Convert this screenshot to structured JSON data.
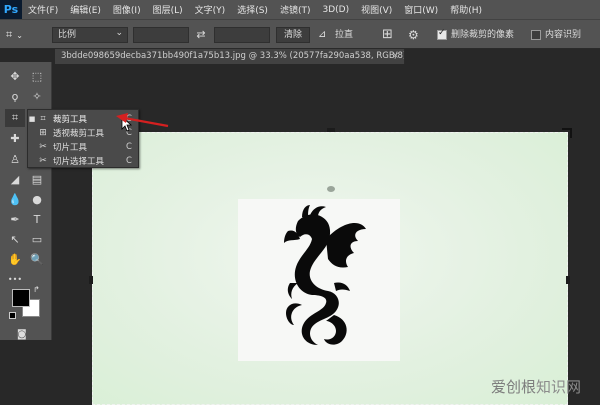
{
  "app": {
    "logo": "Ps"
  },
  "menu": [
    "文件(F)",
    "编辑(E)",
    "图像(I)",
    "图层(L)",
    "文字(Y)",
    "选择(S)",
    "滤镜(T)",
    "3D(D)",
    "视图(V)",
    "窗口(W)",
    "帮助(H)"
  ],
  "options": {
    "ratio": "比例",
    "clear": "清除",
    "straighten": "拉直",
    "delete_cropped": {
      "label": "删除裁剪的像素",
      "checked": true
    },
    "content_aware": {
      "label": "内容识别",
      "checked": false
    }
  },
  "document": {
    "tab_title": "3bdde098659decba371bb490f1a75b13.jpg @ 33.3% (20577fa290aa538, RGB/8) *",
    "close": "×"
  },
  "tools": {
    "move": "✥",
    "marquee": "⬚",
    "lasso": "ϙ",
    "magic_wand": "✧",
    "crop": "⌗",
    "eyedropper": "✎",
    "healing": "✚",
    "brush": "✐",
    "stamp": "♙",
    "history": "⟲",
    "eraser": "◢",
    "gradient": "▤",
    "blur": "💧",
    "dodge": "●",
    "pen": "✒",
    "type": "T",
    "path_select": "↖",
    "rectangle": "▭",
    "hand": "✋",
    "zoom": "🔍",
    "more": "•••"
  },
  "flyout": [
    {
      "icon": "⌗",
      "label": "裁剪工具",
      "key": "C",
      "selected": true
    },
    {
      "icon": "⊞",
      "label": "透视裁剪工具",
      "key": "C",
      "selected": false
    },
    {
      "icon": "✂",
      "label": "切片工具",
      "key": "C",
      "selected": false
    },
    {
      "icon": "✂",
      "label": "切片选择工具",
      "key": "C",
      "selected": false
    }
  ],
  "colors": {
    "foreground": "#000000",
    "background": "#ffffff",
    "annotation_arrow": "#d42020"
  },
  "watermark": {
    "part1": "爱创根",
    "part2": "知识网"
  }
}
